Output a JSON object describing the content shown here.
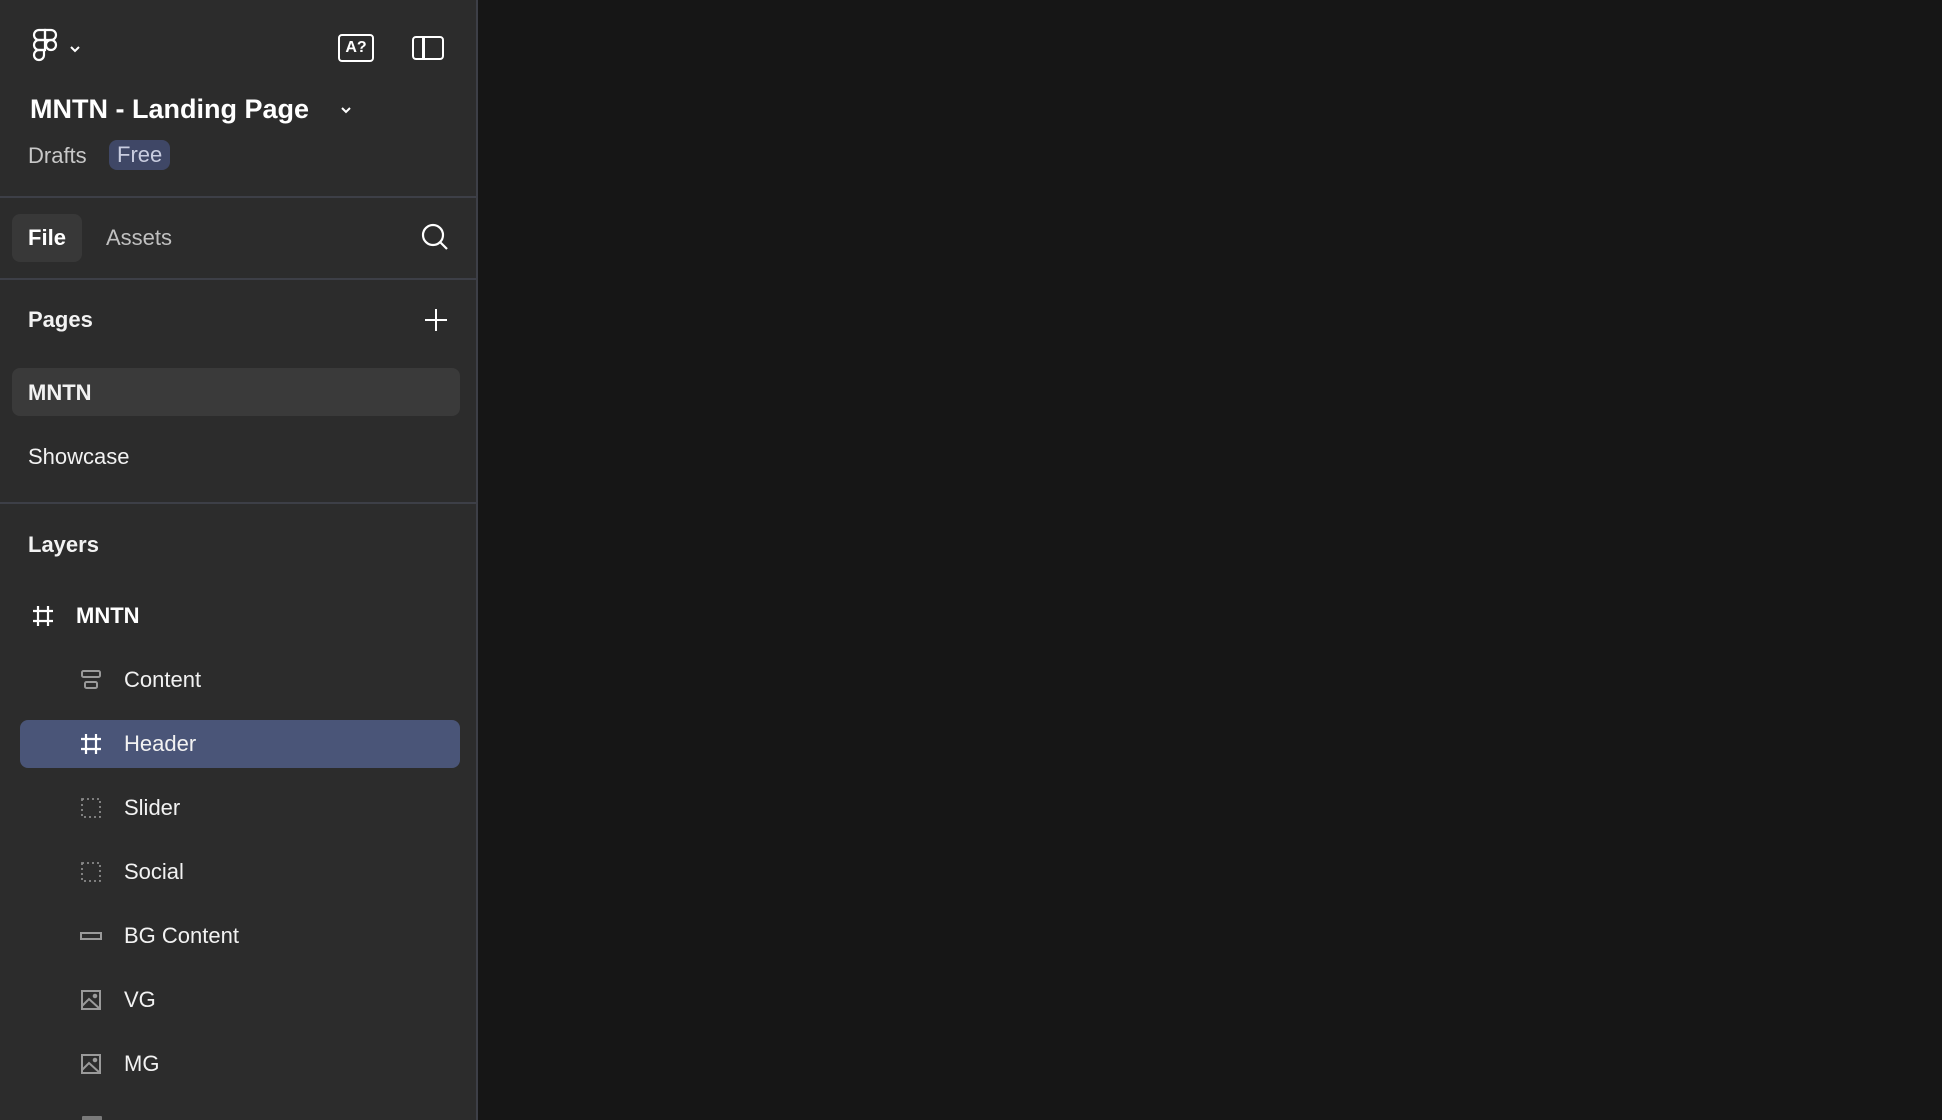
{
  "header": {
    "title": "MNTN - Landing Page",
    "location": "Drafts",
    "plan_badge": "Free"
  },
  "tabs": [
    {
      "label": "File",
      "active": true
    },
    {
      "label": "Assets",
      "active": false
    }
  ],
  "pages": {
    "title": "Pages",
    "items": [
      {
        "label": "MNTN",
        "selected": true
      },
      {
        "label": "Showcase",
        "selected": false
      }
    ]
  },
  "layers": {
    "title": "Layers",
    "root": {
      "label": "MNTN",
      "icon": "frame-icon"
    },
    "items": [
      {
        "label": "Content",
        "icon": "auto-layout-icon",
        "selected": false
      },
      {
        "label": "Header",
        "icon": "frame-icon",
        "selected": true
      },
      {
        "label": "Slider",
        "icon": "section-dashed-icon",
        "selected": false
      },
      {
        "label": "Social",
        "icon": "section-dashed-icon",
        "selected": false
      },
      {
        "label": "BG Content",
        "icon": "rectangle-icon",
        "selected": false
      },
      {
        "label": "VG",
        "icon": "image-icon",
        "selected": false
      },
      {
        "label": "MG",
        "icon": "image-icon",
        "selected": false
      }
    ]
  },
  "colors": {
    "sidebar": "#2c2c2c",
    "canvas": "#161616",
    "selection": "#4a5578",
    "badge": "#3f4766"
  }
}
